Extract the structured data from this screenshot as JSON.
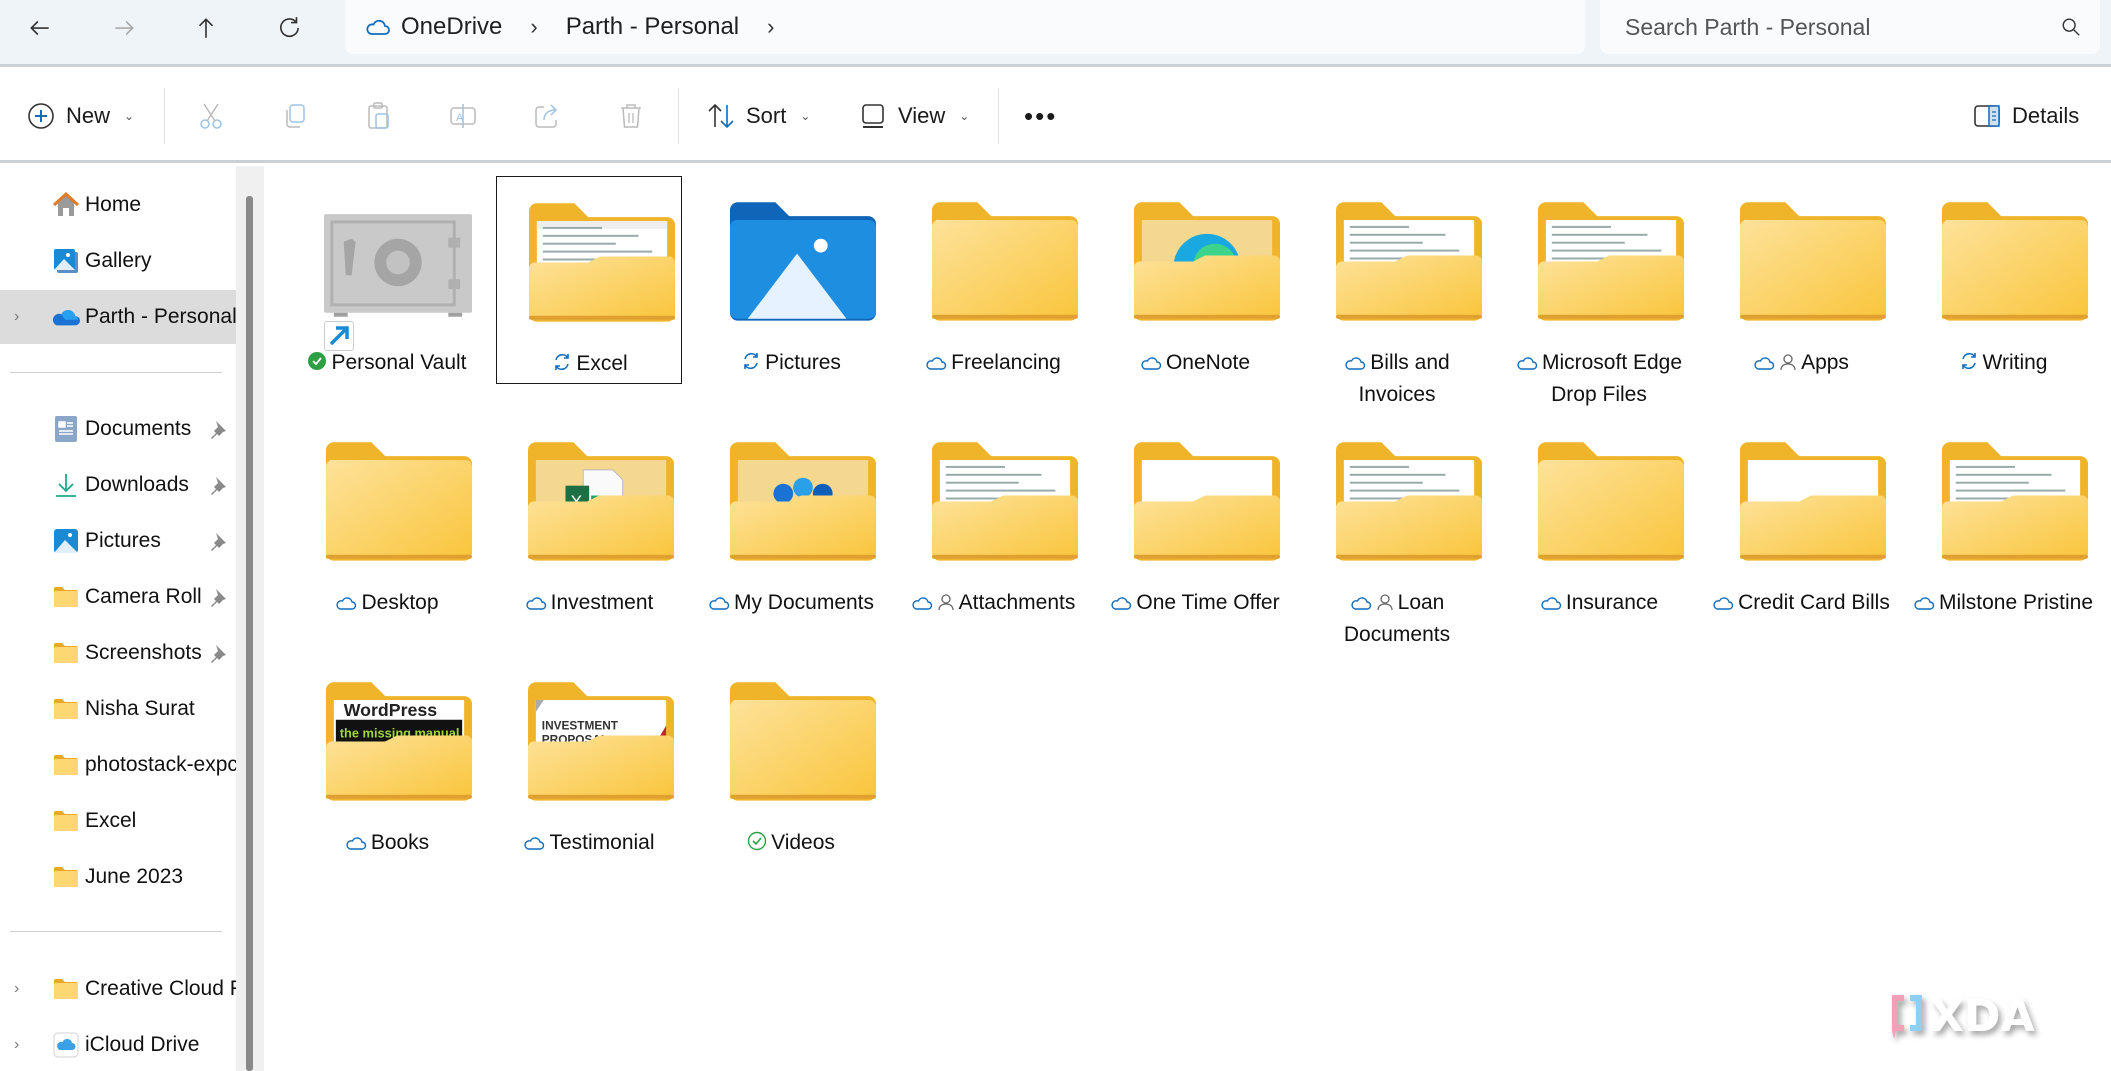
{
  "nav": {
    "back_label": "Back",
    "forward_label": "Forward",
    "up_label": "Up",
    "refresh_label": "Refresh"
  },
  "address": {
    "crumbs": [
      {
        "label": "OneDrive",
        "icon": "cloud-icon"
      },
      {
        "label": "Parth - Personal"
      }
    ]
  },
  "search": {
    "placeholder": "Search Parth - Personal",
    "value": ""
  },
  "toolbar": {
    "new_label": "New",
    "cut_label": "Cut",
    "copy_label": "Copy",
    "paste_label": "Paste",
    "rename_label": "Rename",
    "share_label": "Share",
    "delete_label": "Delete",
    "sort_label": "Sort",
    "view_label": "View",
    "more_label": "More options",
    "details_label": "Details"
  },
  "sidebar": {
    "items": [
      {
        "label": "Home",
        "icon": "home-icon"
      },
      {
        "label": "Gallery",
        "icon": "gallery-icon"
      },
      {
        "label": "Parth - Personal",
        "icon": "onedrive-icon",
        "selected": true,
        "expandable": true
      },
      {
        "label": "Documents",
        "icon": "documents-icon",
        "pinned": true
      },
      {
        "label": "Downloads",
        "icon": "downloads-icon",
        "pinned": true
      },
      {
        "label": "Pictures",
        "icon": "pictures-icon",
        "pinned": true
      },
      {
        "label": "Camera Roll",
        "icon": "folder-icon",
        "pinned": true
      },
      {
        "label": "Screenshots",
        "icon": "folder-icon",
        "pinned": true
      },
      {
        "label": "Nisha Surat",
        "icon": "folder-icon"
      },
      {
        "label": "photostack-expc",
        "icon": "folder-icon"
      },
      {
        "label": "Excel",
        "icon": "folder-icon"
      },
      {
        "label": "June 2023",
        "icon": "folder-icon"
      },
      {
        "label": "Creative Cloud F",
        "icon": "folder-icon",
        "expandable": true
      },
      {
        "label": "iCloud Drive",
        "icon": "icloud-icon",
        "expandable": true
      }
    ]
  },
  "items": [
    {
      "name": "Personal Vault",
      "status": "synced-filled",
      "thumb": "vault",
      "shortcut": true
    },
    {
      "name": "Excel",
      "status": "syncing",
      "thumb": "folder-sheet",
      "selected": true
    },
    {
      "name": "Pictures",
      "status": "syncing",
      "thumb": "pictures"
    },
    {
      "name": "Freelancing",
      "status": "cloud",
      "thumb": "folder-empty"
    },
    {
      "name": "OneNote",
      "status": "cloud",
      "thumb": "folder-edge"
    },
    {
      "name": "Bills and Invoices",
      "status": "cloud",
      "thumb": "folder-doc"
    },
    {
      "name": "Microsoft Edge Drop Files",
      "status": "cloud",
      "thumb": "folder-doc"
    },
    {
      "name": "Apps",
      "status": "cloud",
      "shared": true,
      "thumb": "folder-empty"
    },
    {
      "name": "Writing",
      "status": "syncing",
      "thumb": "folder-empty"
    },
    {
      "name": "Desktop",
      "status": "cloud",
      "thumb": "folder-empty"
    },
    {
      "name": "Investment",
      "status": "cloud",
      "thumb": "folder-excel"
    },
    {
      "name": "My Documents",
      "status": "cloud",
      "thumb": "folder-people"
    },
    {
      "name": "Attachments",
      "status": "cloud",
      "shared": true,
      "thumb": "folder-doc"
    },
    {
      "name": "One Time Offer",
      "status": "cloud",
      "thumb": "folder-white"
    },
    {
      "name": "Loan Documents",
      "status": "cloud",
      "shared": true,
      "thumb": "folder-doc"
    },
    {
      "name": "Insurance",
      "status": "cloud",
      "thumb": "folder-plain"
    },
    {
      "name": "Credit Card Bills",
      "status": "cloud",
      "thumb": "folder-white"
    },
    {
      "name": "Milstone Pristine",
      "status": "cloud",
      "thumb": "folder-doc"
    },
    {
      "name": "Books",
      "status": "cloud",
      "thumb": "folder-book"
    },
    {
      "name": "Testimonial",
      "status": "cloud",
      "thumb": "folder-proposal"
    },
    {
      "name": "Videos",
      "status": "synced-outline",
      "thumb": "folder-empty"
    }
  ],
  "thumb_text": {
    "book_title": "WordPress",
    "book_subtitle": "the missing manual",
    "proposal_line1": "INVESTMENT",
    "proposal_line2": "PROPOSAL"
  },
  "watermark": "XDA",
  "colors": {
    "accent": "#0f6cbd",
    "folder": "#f8c84a",
    "folder_dark": "#e8a92a",
    "synced": "#2ea043",
    "selected_sidebar": "#dcdcdc"
  }
}
